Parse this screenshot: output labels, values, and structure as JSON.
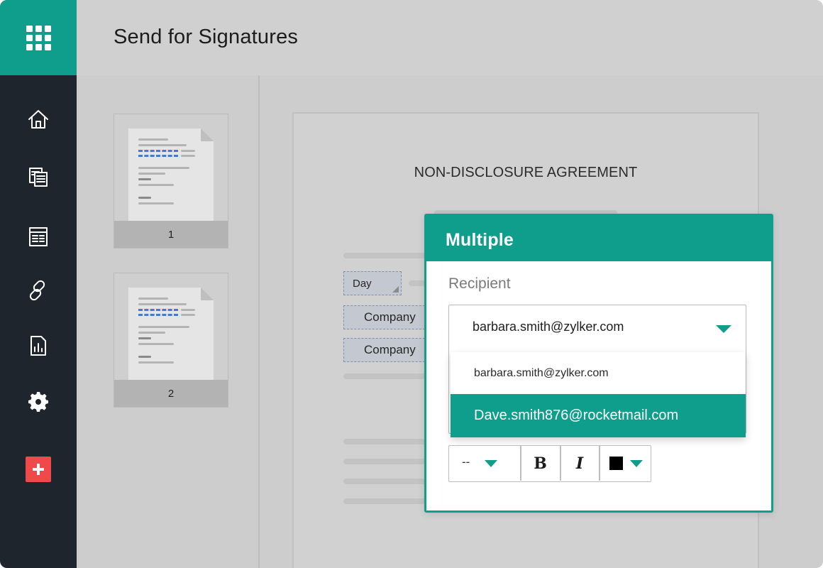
{
  "header": {
    "title": "Send for Signatures"
  },
  "sidebar": {
    "items": [
      {
        "icon": "home-icon"
      },
      {
        "icon": "documents-icon"
      },
      {
        "icon": "template-icon"
      },
      {
        "icon": "link-icon"
      },
      {
        "icon": "report-icon"
      },
      {
        "icon": "gear-icon"
      },
      {
        "icon": "plus-icon"
      }
    ]
  },
  "thumbnails": [
    {
      "page": "1"
    },
    {
      "page": "2"
    }
  ],
  "document": {
    "title": "NON-DISCLOSURE AGREEMENT",
    "fields": [
      "Day",
      "Company",
      "Company"
    ]
  },
  "popup": {
    "title": "Multiple",
    "recipient_label": "Recipient",
    "selected_recipient": "barbara.smith@zylker.com",
    "options": [
      "barbara.smith@zylker.com",
      "Dave.smith876@rocketmail.com"
    ],
    "highlighted_option": "Dave.smith876@rocketmail.com",
    "toolbar": {
      "font_size": "--",
      "bold_label": "B",
      "italic_label": "I",
      "text_color": "#000000"
    }
  },
  "colors": {
    "accent": "#0f9e8c",
    "sidebar": "#1f252d",
    "add_button": "#f0494a"
  }
}
